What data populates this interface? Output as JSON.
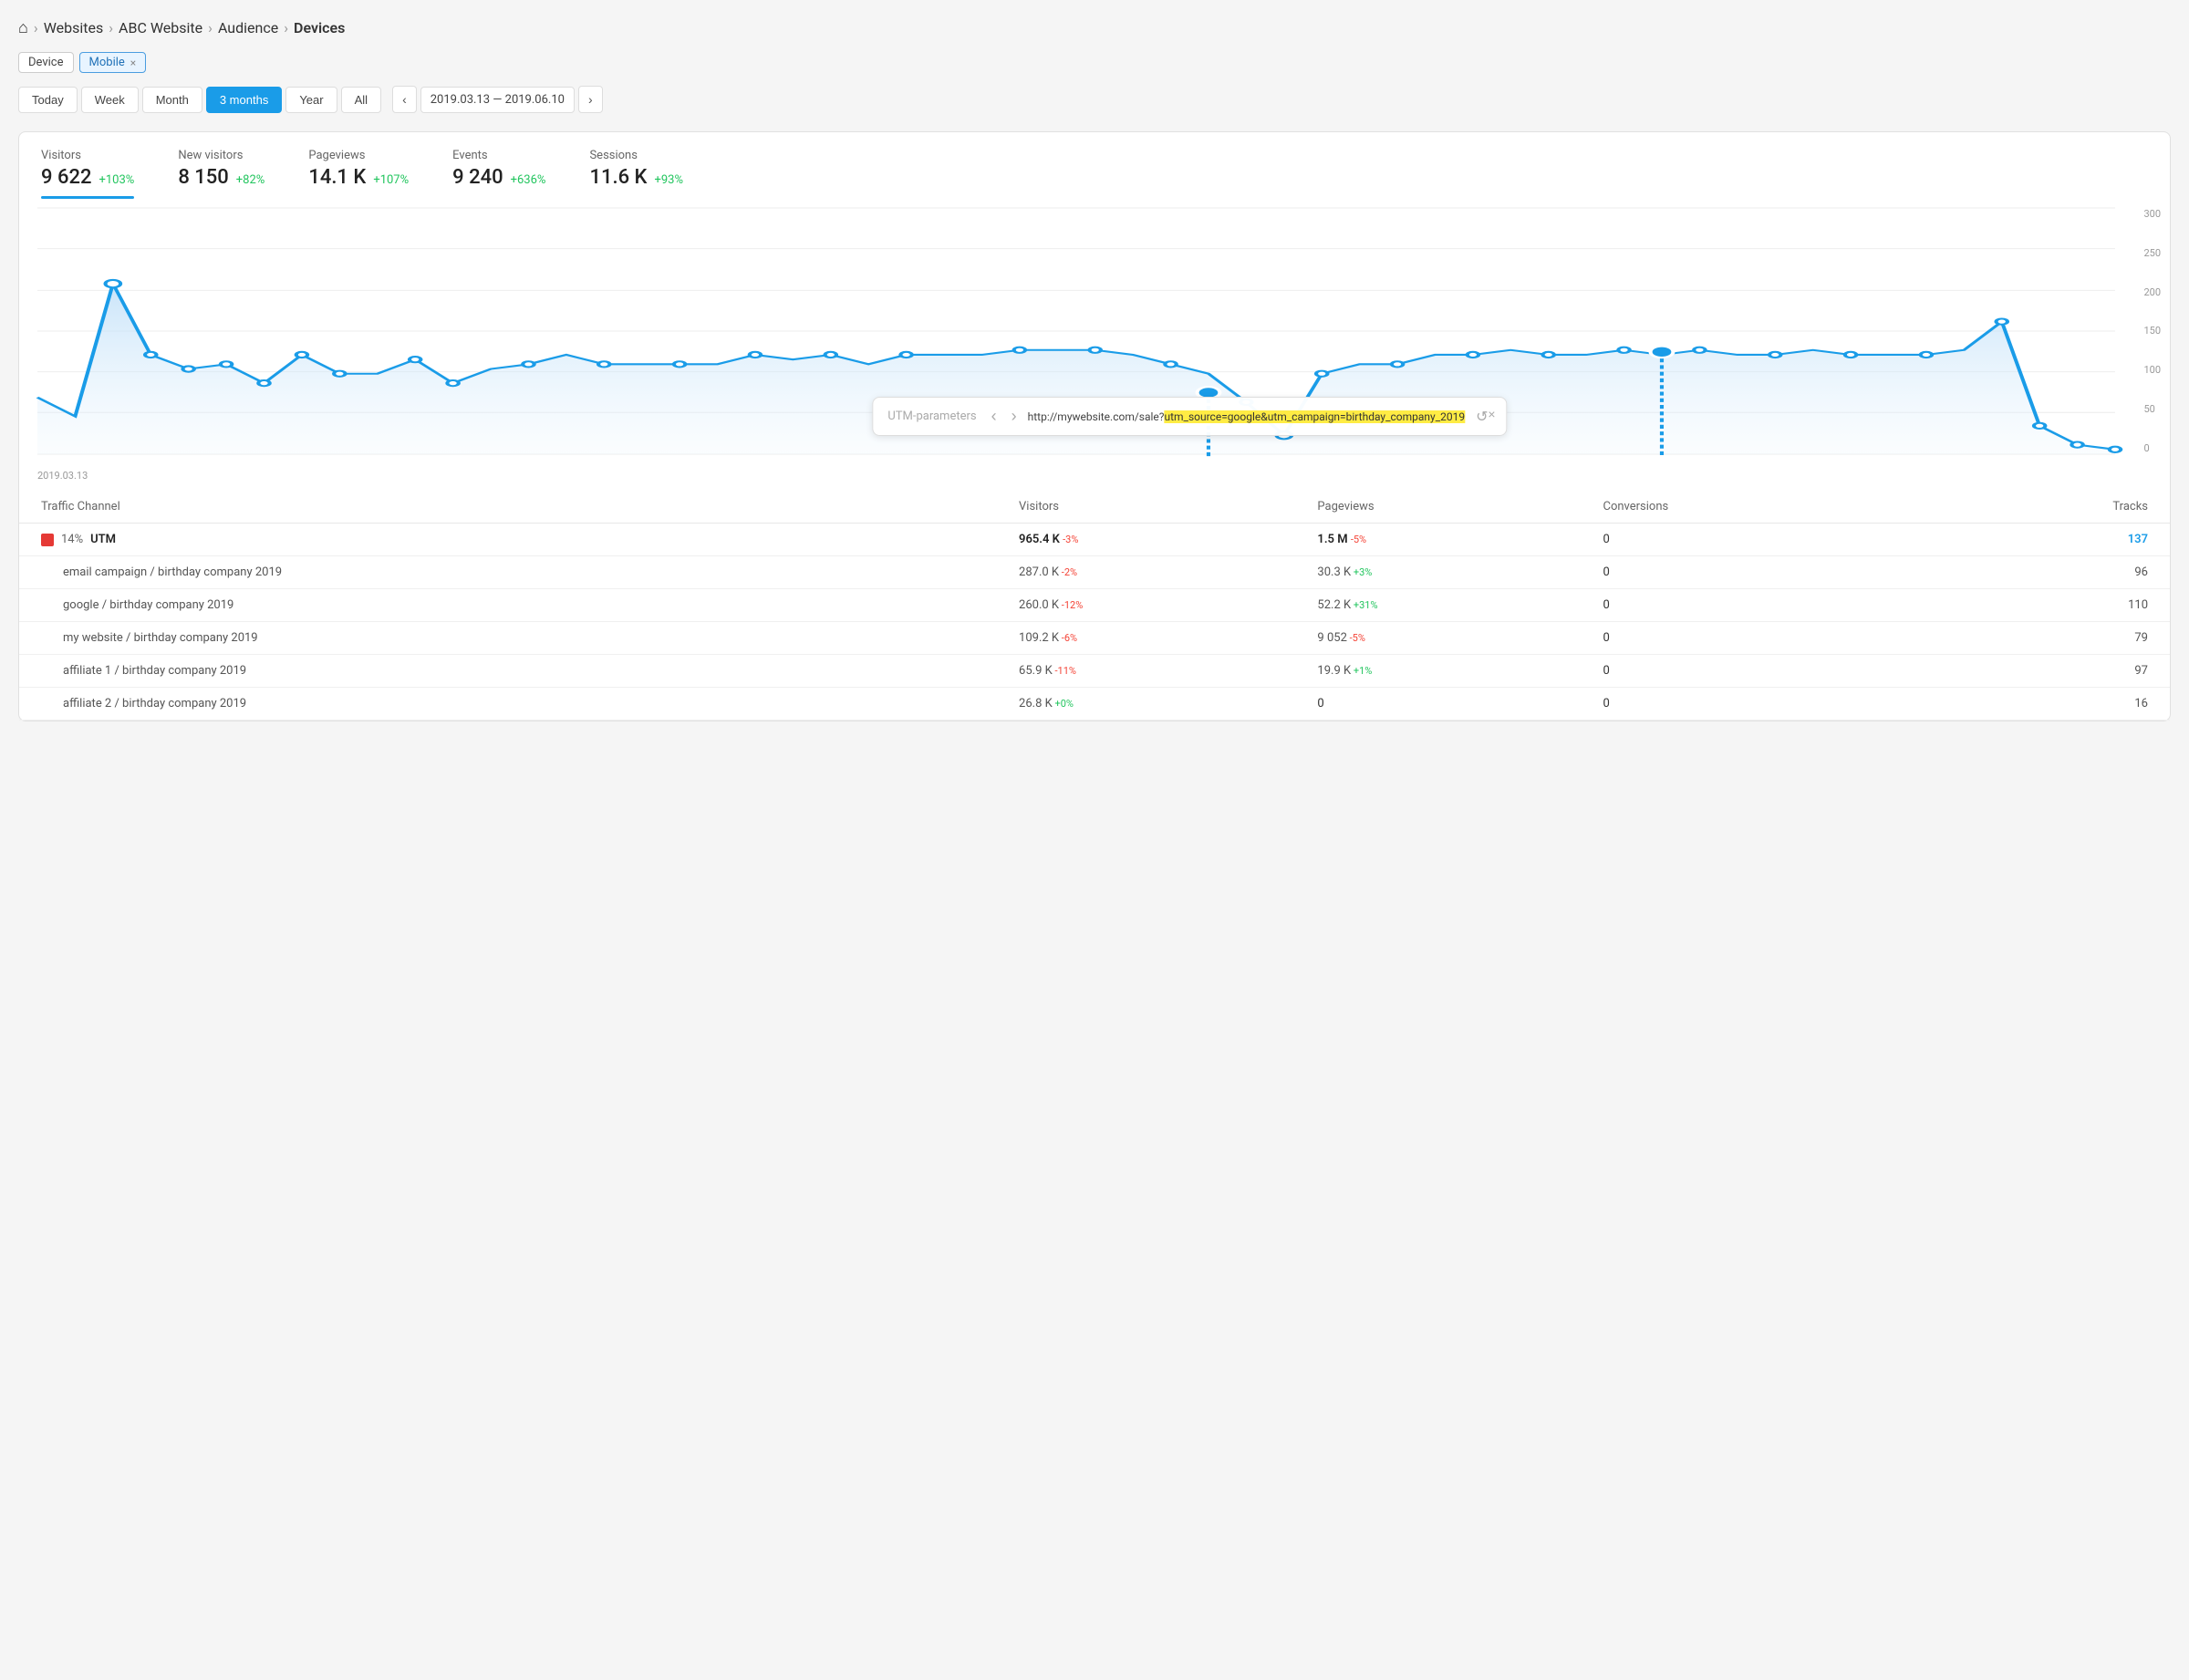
{
  "breadcrumb": {
    "items": [
      "Websites",
      "ABC Website",
      "Audience",
      "Devices"
    ]
  },
  "filters": [
    {
      "label": "Device",
      "active": false
    },
    {
      "label": "Mobile",
      "active": true,
      "removable": true
    }
  ],
  "toolbar": {
    "periods": [
      "Today",
      "Week",
      "Month",
      "3 months",
      "Year",
      "All"
    ],
    "active_period": "3 months",
    "date_range": "2019.03.13 — 2019.06.10"
  },
  "stats": [
    {
      "label": "Visitors",
      "value": "9 622",
      "change": "+103%",
      "underline": true
    },
    {
      "label": "New visitors",
      "value": "8 150",
      "change": "+82%"
    },
    {
      "label": "Pageviews",
      "value": "14.1 K",
      "change": "+107%"
    },
    {
      "label": "Events",
      "value": "9 240",
      "change": "+636%"
    },
    {
      "label": "Sessions",
      "value": "11.6 K",
      "change": "+93%"
    }
  ],
  "chart": {
    "y_labels": [
      "300",
      "250",
      "200",
      "150",
      "100",
      "50",
      "0"
    ],
    "x_label": "2019.03.13"
  },
  "utm_overlay": {
    "title": "UTM-parameters",
    "url_prefix": "http://mywebsite.com/sale?",
    "url_highlight": "utm_source=google&utm_campaign=birthday_company_2019"
  },
  "table": {
    "headers": [
      "Traffic Channel",
      "Visitors",
      "Pageviews",
      "Conversions",
      "Tracks"
    ],
    "rows": [
      {
        "type": "main",
        "badge_color": "#e53935",
        "percent": "14%",
        "name": "UTM",
        "visitors": "965.4 K",
        "visitors_change": "-3%",
        "pageviews": "1.5 M",
        "pageviews_change": "-5%",
        "conversions": "0",
        "tracks": "137",
        "tracks_type": "blue"
      },
      {
        "type": "sub",
        "name": "email campaign / birthday company 2019",
        "visitors": "287.0 K",
        "visitors_change": "-2%",
        "pageviews": "30.3 K",
        "pageviews_change": "+3%",
        "conversions": "0",
        "tracks": "96"
      },
      {
        "type": "sub",
        "name": "google / birthday company 2019",
        "visitors": "260.0 K",
        "visitors_change": "-12%",
        "pageviews": "52.2 K",
        "pageviews_change": "+31%",
        "conversions": "0",
        "tracks": "110"
      },
      {
        "type": "sub",
        "name": "my website / birthday company 2019",
        "visitors": "109.2 K",
        "visitors_change": "-6%",
        "pageviews": "9 052",
        "pageviews_change": "-5%",
        "conversions": "0",
        "tracks": "79"
      },
      {
        "type": "sub",
        "name": "affiliate 1 / birthday company 2019",
        "visitors": "65.9 K",
        "visitors_change": "-11%",
        "pageviews": "19.9 K",
        "pageviews_change": "+1%",
        "conversions": "0",
        "tracks": "97"
      },
      {
        "type": "sub",
        "name": "affiliate 2 / birthday company 2019",
        "visitors": "26.8 K",
        "visitors_change": "+0%",
        "pageviews": "0",
        "pageviews_change": "",
        "conversions": "0",
        "tracks": "16"
      }
    ]
  }
}
